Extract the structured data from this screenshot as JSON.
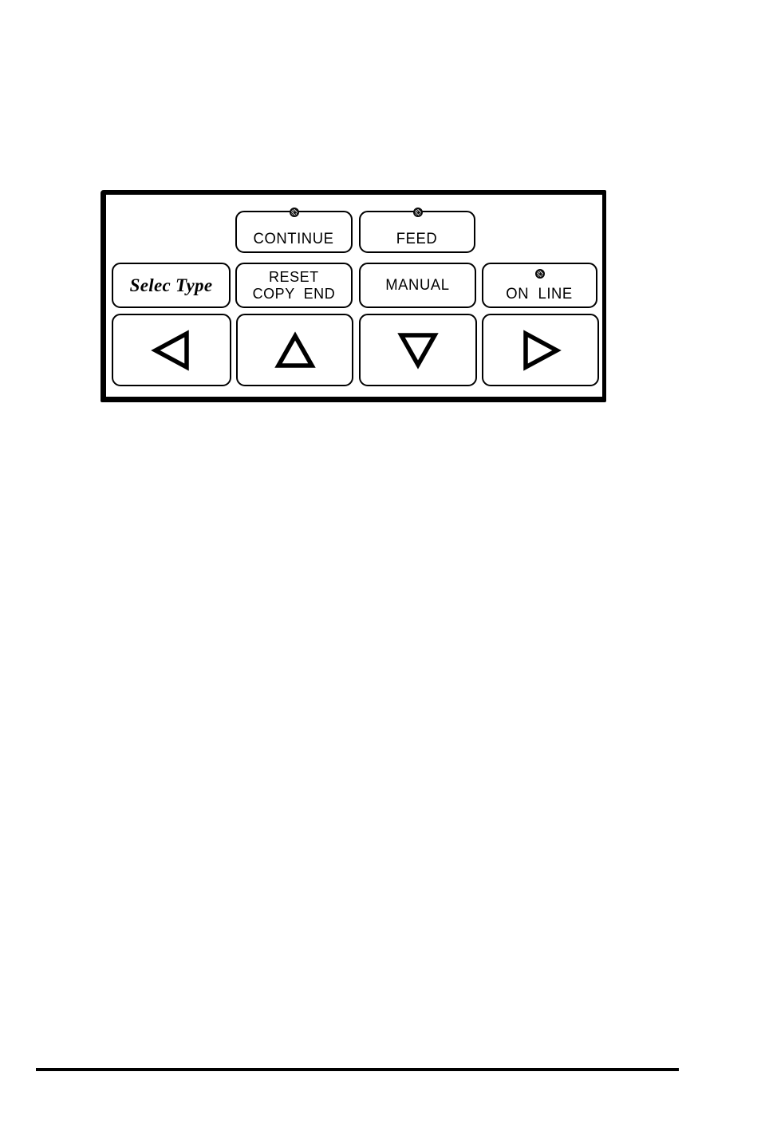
{
  "page": {
    "background_color": "#ffffff",
    "ink_color": "#000000"
  },
  "figure": {
    "name": "printer-control-panel",
    "description": "Printer operator control panel line drawing",
    "frame": {
      "border_color": "#000000",
      "fill_color": "#ffffff"
    }
  },
  "panel": {
    "rows": [
      {
        "name": "indicator-key-row",
        "keys": [
          {
            "id": "continue",
            "label": "CONTINUE",
            "has_led": true,
            "led_state": "lit"
          },
          {
            "id": "feed",
            "label": "FEED",
            "has_led": true,
            "led_state": "lit"
          }
        ]
      },
      {
        "name": "function-key-row",
        "keys": [
          {
            "id": "selec-type",
            "label": "Selec Type",
            "style": "serif-italic",
            "has_led": false
          },
          {
            "id": "reset-copy-end",
            "label_line1": "RESET",
            "label_line2": "COPY  END",
            "has_led": false
          },
          {
            "id": "manual",
            "label": "MANUAL",
            "has_led": false
          },
          {
            "id": "on-line",
            "label": "ON  LINE",
            "has_led": true,
            "led_state": "lit"
          }
        ]
      },
      {
        "name": "navigation-key-row",
        "keys": [
          {
            "id": "left",
            "icon": "triangle-left-icon",
            "glyph": "◁"
          },
          {
            "id": "up",
            "icon": "triangle-up-icon",
            "glyph": "△"
          },
          {
            "id": "down",
            "icon": "triangle-down-icon",
            "glyph": "▽"
          },
          {
            "id": "right",
            "icon": "triangle-right-icon",
            "glyph": "▷"
          }
        ]
      }
    ]
  },
  "footer": {
    "rule_color": "#000000"
  }
}
